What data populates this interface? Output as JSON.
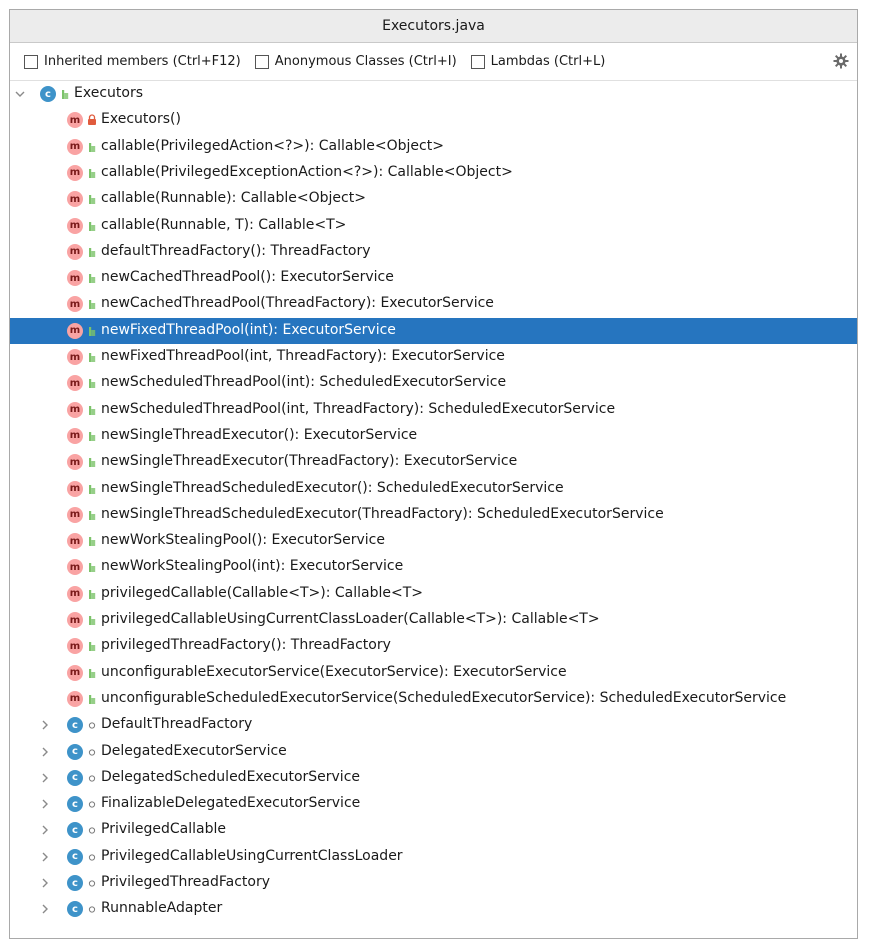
{
  "window": {
    "title": "Executors.java"
  },
  "toolbar": {
    "options": [
      {
        "label": "Inherited members (Ctrl+F12)",
        "checked": false
      },
      {
        "label": "Anonymous Classes (Ctrl+I)",
        "checked": false
      },
      {
        "label": "Lambdas (Ctrl+L)",
        "checked": false
      }
    ],
    "settings_icon": "gear-icon"
  },
  "colors": {
    "selection": "#2675bf",
    "method_icon": "#f9a3a3",
    "class_icon": "#3e93c9",
    "public_icon": "#7cc36a",
    "private_icon": "#e05b3d"
  },
  "tree": {
    "root": {
      "label": "Executors",
      "icon": "class-icon",
      "visibility": "public",
      "expanded": true
    },
    "members": [
      {
        "label": "Executors()",
        "visibility": "private",
        "selected": false
      },
      {
        "label": "callable(PrivilegedAction<?>): Callable<Object>",
        "visibility": "public",
        "selected": false
      },
      {
        "label": "callable(PrivilegedExceptionAction<?>): Callable<Object>",
        "visibility": "public",
        "selected": false
      },
      {
        "label": "callable(Runnable): Callable<Object>",
        "visibility": "public",
        "selected": false
      },
      {
        "label": "callable(Runnable, T): Callable<T>",
        "visibility": "public",
        "selected": false
      },
      {
        "label": "defaultThreadFactory(): ThreadFactory",
        "visibility": "public",
        "selected": false
      },
      {
        "label": "newCachedThreadPool(): ExecutorService",
        "visibility": "public",
        "selected": false
      },
      {
        "label": "newCachedThreadPool(ThreadFactory): ExecutorService",
        "visibility": "public",
        "selected": false
      },
      {
        "label": "newFixedThreadPool(int): ExecutorService",
        "visibility": "public",
        "selected": true
      },
      {
        "label": "newFixedThreadPool(int, ThreadFactory): ExecutorService",
        "visibility": "public",
        "selected": false
      },
      {
        "label": "newScheduledThreadPool(int): ScheduledExecutorService",
        "visibility": "public",
        "selected": false
      },
      {
        "label": "newScheduledThreadPool(int, ThreadFactory): ScheduledExecutorService",
        "visibility": "public",
        "selected": false
      },
      {
        "label": "newSingleThreadExecutor(): ExecutorService",
        "visibility": "public",
        "selected": false
      },
      {
        "label": "newSingleThreadExecutor(ThreadFactory): ExecutorService",
        "visibility": "public",
        "selected": false
      },
      {
        "label": "newSingleThreadScheduledExecutor(): ScheduledExecutorService",
        "visibility": "public",
        "selected": false
      },
      {
        "label": "newSingleThreadScheduledExecutor(ThreadFactory): ScheduledExecutorService",
        "visibility": "public",
        "selected": false
      },
      {
        "label": "newWorkStealingPool(): ExecutorService",
        "visibility": "public",
        "selected": false
      },
      {
        "label": "newWorkStealingPool(int): ExecutorService",
        "visibility": "public",
        "selected": false
      },
      {
        "label": "privilegedCallable(Callable<T>): Callable<T>",
        "visibility": "public",
        "selected": false
      },
      {
        "label": "privilegedCallableUsingCurrentClassLoader(Callable<T>): Callable<T>",
        "visibility": "public",
        "selected": false
      },
      {
        "label": "privilegedThreadFactory(): ThreadFactory",
        "visibility": "public",
        "selected": false
      },
      {
        "label": "unconfigurableExecutorService(ExecutorService): ExecutorService",
        "visibility": "public",
        "selected": false
      },
      {
        "label": "unconfigurableScheduledExecutorService(ScheduledExecutorService): ScheduledExecutorService",
        "visibility": "public",
        "selected": false
      }
    ],
    "inner_classes": [
      {
        "label": "DefaultThreadFactory",
        "visibility": "package"
      },
      {
        "label": "DelegatedExecutorService",
        "visibility": "package"
      },
      {
        "label": "DelegatedScheduledExecutorService",
        "visibility": "package"
      },
      {
        "label": "FinalizableDelegatedExecutorService",
        "visibility": "package"
      },
      {
        "label": "PrivilegedCallable",
        "visibility": "package"
      },
      {
        "label": "PrivilegedCallableUsingCurrentClassLoader",
        "visibility": "package"
      },
      {
        "label": "PrivilegedThreadFactory",
        "visibility": "package"
      },
      {
        "label": "RunnableAdapter",
        "visibility": "package"
      }
    ]
  }
}
